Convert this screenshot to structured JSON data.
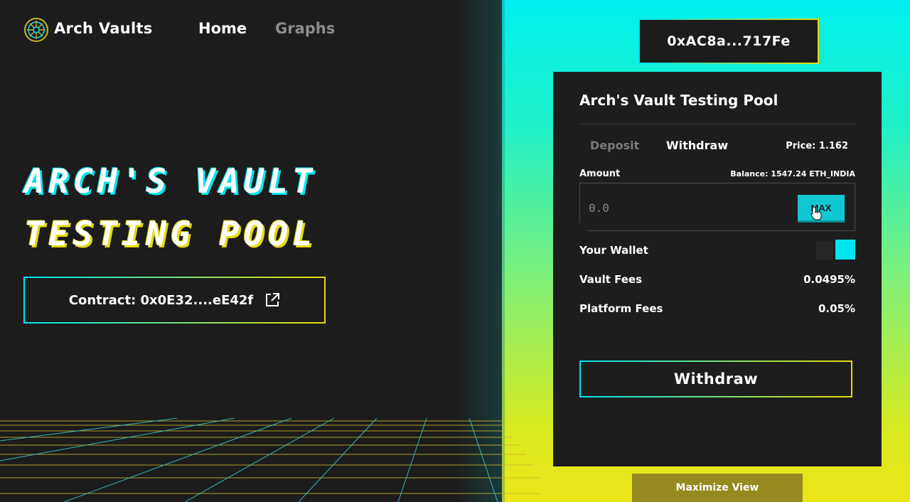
{
  "nav": {
    "brand": "Arch Vaults",
    "home": "Home",
    "graphs": "Graphs"
  },
  "hero": {
    "line1": "ARCH'S VAULT",
    "line2": "TESTING POOL",
    "contract_label": "Contract: 0x0E32....eE42f"
  },
  "wallet": {
    "address": "0xAC8a...717Fe"
  },
  "panel": {
    "title": "Arch's Vault Testing Pool",
    "tabs": {
      "deposit": "Deposit",
      "withdraw": "Withdraw"
    },
    "price": "Price: 1.162",
    "amount_label": "Amount",
    "balance": "Balance: 1547.24 ETH_INDIA",
    "amount_placeholder": "0.0",
    "max_label": "MAX",
    "rows": {
      "your_wallet": "Your Wallet",
      "vault_fees_label": "Vault Fees",
      "vault_fees_value": "0.0495%",
      "platform_fees_label": "Platform Fees",
      "platform_fees_value": "0.05%"
    },
    "submit": "Withdraw"
  },
  "footer": {
    "maximize": "Maximize View"
  },
  "icons": {
    "logo": "arch-logo-icon",
    "external": "external-link-icon",
    "cursor": "hand-cursor-icon"
  },
  "colors": {
    "accent_cyan": "#00e5f0",
    "accent_yellow": "#e6d90a",
    "panel_bg": "#1d1d1d",
    "max_button": "#10c8d2"
  }
}
